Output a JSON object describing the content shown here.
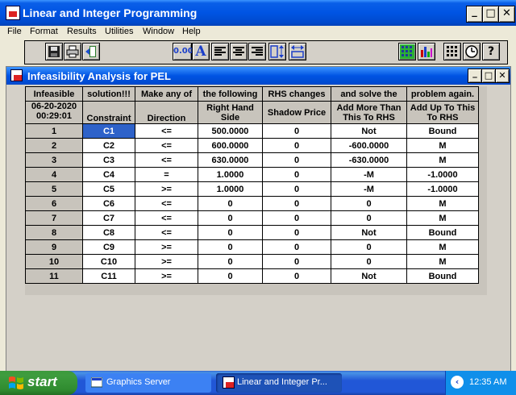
{
  "window": {
    "title": "Linear and Integer Programming",
    "minimize": "_",
    "maximize": "□",
    "close": "✕"
  },
  "menu": [
    "File",
    "Format",
    "Results",
    "Utilities",
    "Window",
    "Help"
  ],
  "toolbar": {
    "decimal_label": "0.00",
    "font_label": "A",
    "icons": [
      "save-icon",
      "print-icon",
      "exit-icon",
      "font-icon",
      "align-left-icon",
      "align-center-icon",
      "align-right-icon",
      "column-height-icon",
      "column-width-icon",
      "grid-icon",
      "bar-chart-icon",
      "calculator-icon",
      "clock-icon",
      "help-icon"
    ],
    "help_label": "?"
  },
  "child_window": {
    "title": "Infeasibility Analysis for PEL",
    "minimize": "_",
    "maximize": "□",
    "close": "✕"
  },
  "table": {
    "banner": [
      "Infeasible",
      "solution!!!",
      "Make any of",
      "the following",
      "RHS changes",
      "and solve the",
      "problem again."
    ],
    "header_date": "06-20-2020",
    "header_time": "00:29:01",
    "headers": [
      "Constraint",
      "Direction",
      "Right Hand Side",
      "Shadow Price",
      "Add More Than This To RHS",
      "Add Up To This To RHS"
    ],
    "rows": [
      {
        "num": "1",
        "constraint": "C1",
        "direction": "<=",
        "rhs": "500.0000",
        "shadow": "0",
        "add_more": "Not",
        "add_up": "Bound"
      },
      {
        "num": "2",
        "constraint": "C2",
        "direction": "<=",
        "rhs": "600.0000",
        "shadow": "0",
        "add_more": "-600.0000",
        "add_up": "M"
      },
      {
        "num": "3",
        "constraint": "C3",
        "direction": "<=",
        "rhs": "630.0000",
        "shadow": "0",
        "add_more": "-630.0000",
        "add_up": "M"
      },
      {
        "num": "4",
        "constraint": "C4",
        "direction": "=",
        "rhs": "1.0000",
        "shadow": "0",
        "add_more": "-M",
        "add_up": "-1.0000"
      },
      {
        "num": "5",
        "constraint": "C5",
        "direction": ">=",
        "rhs": "1.0000",
        "shadow": "0",
        "add_more": "-M",
        "add_up": "-1.0000"
      },
      {
        "num": "6",
        "constraint": "C6",
        "direction": "<=",
        "rhs": "0",
        "shadow": "0",
        "add_more": "0",
        "add_up": "M"
      },
      {
        "num": "7",
        "constraint": "C7",
        "direction": "<=",
        "rhs": "0",
        "shadow": "0",
        "add_more": "0",
        "add_up": "M"
      },
      {
        "num": "8",
        "constraint": "C8",
        "direction": "<=",
        "rhs": "0",
        "shadow": "0",
        "add_more": "Not",
        "add_up": "Bound"
      },
      {
        "num": "9",
        "constraint": "C9",
        "direction": ">=",
        "rhs": "0",
        "shadow": "0",
        "add_more": "0",
        "add_up": "M"
      },
      {
        "num": "10",
        "constraint": "C10",
        "direction": ">=",
        "rhs": "0",
        "shadow": "0",
        "add_more": "0",
        "add_up": "M"
      },
      {
        "num": "11",
        "constraint": "C11",
        "direction": ">=",
        "rhs": "0",
        "shadow": "0",
        "add_more": "Not",
        "add_up": "Bound"
      }
    ],
    "selected_row": 0
  },
  "taskbar": {
    "start_label": "start",
    "tasks": [
      "Graphics Server",
      "Linear and Integer Pr..."
    ],
    "clock": "12:35 AM"
  },
  "colors": {
    "titlebar": "#0054E3",
    "selection": "#2E62C9",
    "taskbar": "#2157D7",
    "start": "#3C9A3C"
  }
}
